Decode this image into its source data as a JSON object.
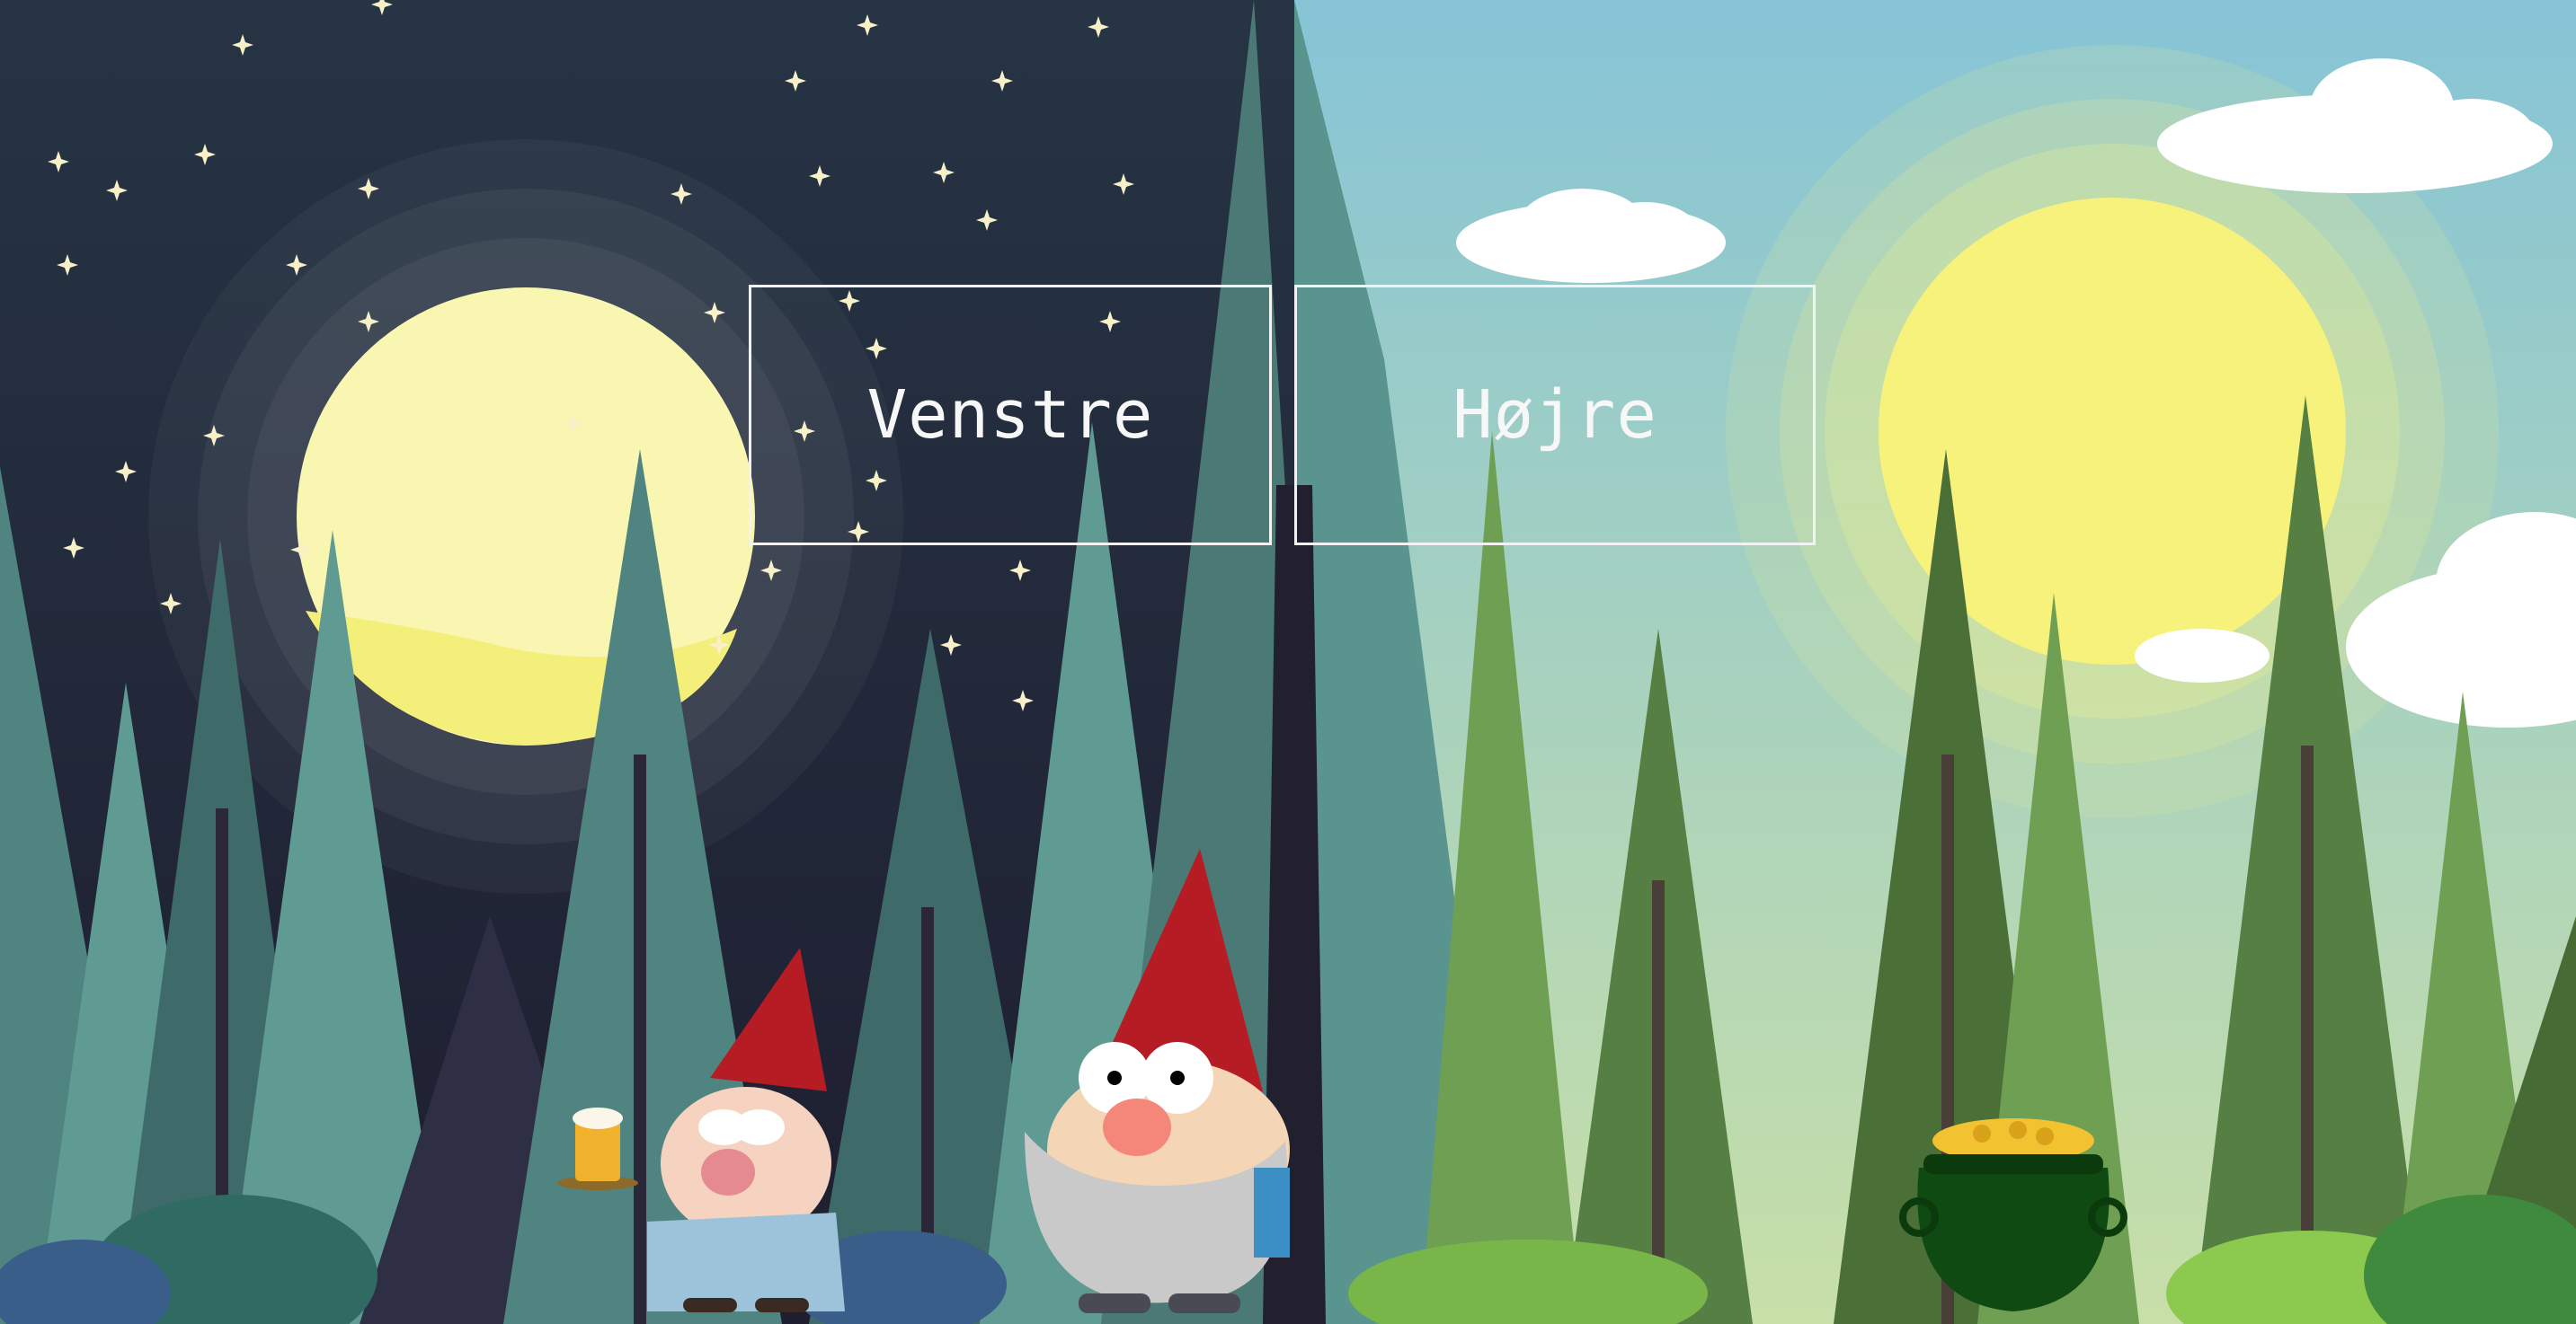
{
  "buttons": {
    "left_label": "Venstre",
    "right_label": "Højre"
  },
  "colors": {
    "night_sky": "#242a3a",
    "day_sky": "#8fc6d4",
    "moon": "#f6f08a",
    "sun": "#f7f27c",
    "night_tree": "#5f9a93",
    "day_tree": "#6f9f52",
    "gnome_hat": "#b51c24",
    "cauldron": "#0f4a12",
    "gold": "#f2c230"
  },
  "scene": {
    "left_side": "night-forest",
    "right_side": "day-forest",
    "characters": [
      "gnome-with-beer-icon",
      "bearded-gnome-icon"
    ],
    "objects": [
      "moon-icon",
      "sun-icon",
      "pot-of-gold-icon",
      "cloud-icon",
      "star-icon"
    ]
  }
}
